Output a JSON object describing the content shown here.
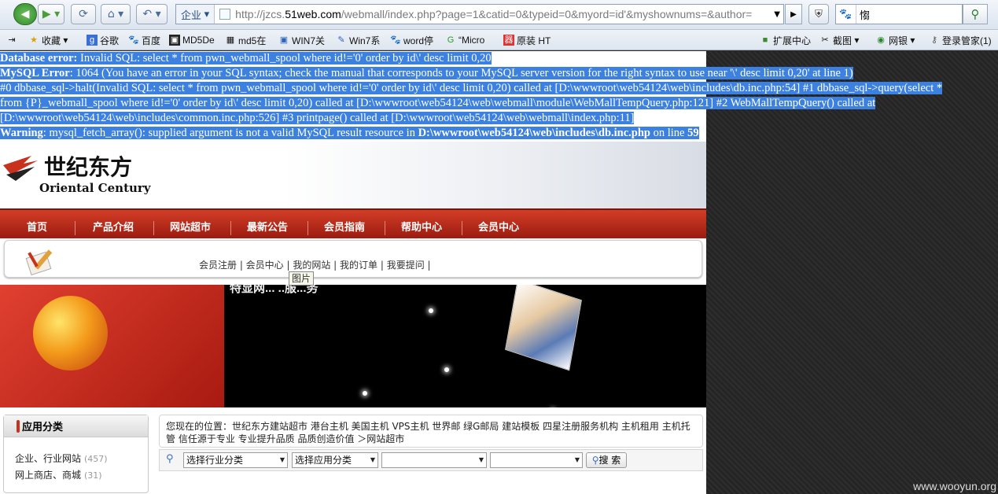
{
  "browser": {
    "address_tag": "企业",
    "url_prefix": "http://jzcs.",
    "url_domain": "51web.com",
    "url_rest": "/webmall/index.php?page=1&catid=0&typeid=0&myord=id'&myshownums=&author=",
    "search_value": "㥮",
    "nav_icons": [
      "back-icon",
      "forward-icon",
      "reload-icon",
      "home-icon",
      "undo-icon"
    ]
  },
  "bookmarks": {
    "left": [
      "收藏",
      "谷歌",
      "百度",
      "MD5De",
      "md5在",
      "WIN7关",
      "Win7系",
      "word停",
      "“Micro",
      "原装 HT"
    ],
    "right": [
      "扩展中心",
      "截图",
      "网银",
      "登录管家(1)"
    ]
  },
  "error": {
    "line1_label": "Database error:",
    "line1_text": " Invalid SQL: select * from pwn_webmall_spool where id!='0' order by id\\' desc limit 0,20",
    "line2_label": "MySQL Error",
    "line2_text": ": 1064 (You have an error in your SQL syntax; check the manual that corresponds to your MySQL server version for the right syntax to use near '\\' desc limit 0,20' at line 1)",
    "line3_text": "#0 dbbase_sql->halt(Invalid SQL: select * from pwn_webmall_spool where id!='0' order by id\\' desc limit 0,20) called at [D:\\wwwroot\\web54124\\web\\includes\\db.inc.php:54] #1 dbbase_sql->query(select *",
    "line4_text": "from {P}_webmall_spool where id!='0' order by id\\' desc limit 0,20) called at [D:\\wwwroot\\web54124\\web\\webmall\\module\\WebMallTempQuery.php:121] #2 WebMallTempQuery() called at",
    "line5_text": "[D:\\wwwroot\\web54124\\web\\includes\\common.inc.php:526] #3 printpage() called at [D:\\wwwroot\\web54124\\web\\webmall\\index.php:11]",
    "line6_label": "Warning",
    "line6_text": ": mysql_fetch_array(): supplied argument is not a valid MySQL result resource in ",
    "line6_file": "D:\\wwwroot\\web54124\\web\\includes\\db.inc.php",
    "line6_mid": " on line ",
    "line6_num": "59"
  },
  "site": {
    "logo_cn": "世纪东方",
    "logo_en": "Oriental Century",
    "menu": [
      "首页",
      "产品介绍",
      "网站超市",
      "最新公告",
      "会员指南",
      "帮助中心",
      "会员中心"
    ],
    "sub_links": "会员注册 | 会员中心 | 我的网站 | 我的订单 | 我要提问 |",
    "tooltip": "图片",
    "banner_text": "特显网...  ..服...务",
    "category_title": "应用分类",
    "categories": [
      {
        "name": "企业、行业网站",
        "count": "(457)"
      },
      {
        "name": "网上商店、商城",
        "count": "(31)"
      }
    ],
    "position_text": "您现在的位置：世纪东方建站超市 港台主机 美国主机 VPS主机 世界邮 绿G邮局 建站模板 四星注册服务机构 主机租用 主机托管 信任源于专业 专业提升品质 品质创造价值 ＞网站超市",
    "filter_industry": "选择行业分类",
    "filter_app": "选择应用分类",
    "filter_third": "",
    "search_btn": "搜 索"
  },
  "watermark": "www.wooyun.org"
}
